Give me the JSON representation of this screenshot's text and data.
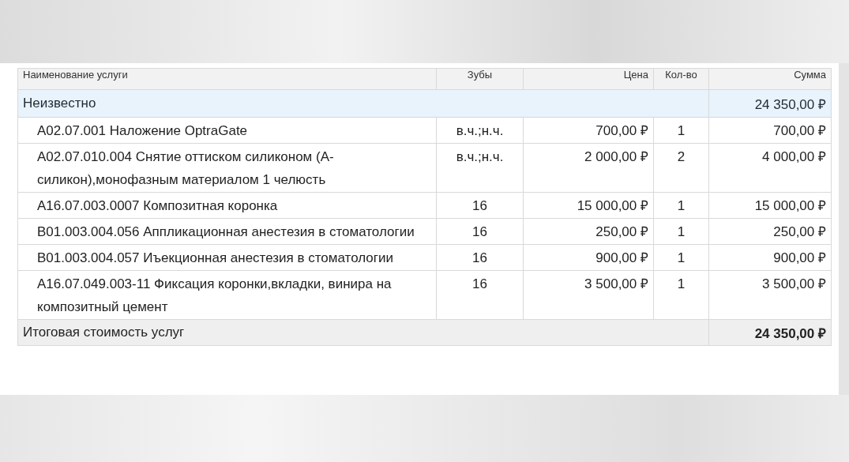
{
  "table": {
    "columns": [
      {
        "label": "Наименование услуги"
      },
      {
        "label": "Зубы"
      },
      {
        "label": "Цена"
      },
      {
        "label": "Кол-во"
      },
      {
        "label": "Сумма"
      }
    ],
    "group": {
      "name": "Неизвестно",
      "total": "24 350,00 ₽"
    },
    "rows": [
      {
        "name": "A02.07.001 Наложение OptraGate",
        "teeth": "в.ч.;н.ч.",
        "price": "700,00 ₽",
        "qty": "1",
        "sum": "700,00 ₽"
      },
      {
        "name": "A02.07.010.004 Снятие оттиском силиконом (А-силикон),монофазным материалом 1 челюсть",
        "teeth": "в.ч.;н.ч.",
        "price": "2 000,00 ₽",
        "qty": "2",
        "sum": "4 000,00 ₽"
      },
      {
        "name": "A16.07.003.0007 Композитная коронка",
        "teeth": "16",
        "price": "15 000,00 ₽",
        "qty": "1",
        "sum": "15 000,00 ₽"
      },
      {
        "name": "B01.003.004.056 Аппликационная анестезия в стоматологии",
        "teeth": "16",
        "price": "250,00 ₽",
        "qty": "1",
        "sum": "250,00 ₽"
      },
      {
        "name": "B01.003.004.057 Иъекционная анестезия в стоматологии",
        "teeth": "16",
        "price": "900,00 ₽",
        "qty": "1",
        "sum": "900,00 ₽"
      },
      {
        "name": "A16.07.049.003-11 Фиксация коронки,вкладки, винира на композитный цемент",
        "teeth": "16",
        "price": "3 500,00 ₽",
        "qty": "1",
        "sum": "3 500,00 ₽"
      }
    ],
    "footer": {
      "label": "Итоговая стоимость услуг",
      "total": "24 350,00 ₽"
    }
  }
}
